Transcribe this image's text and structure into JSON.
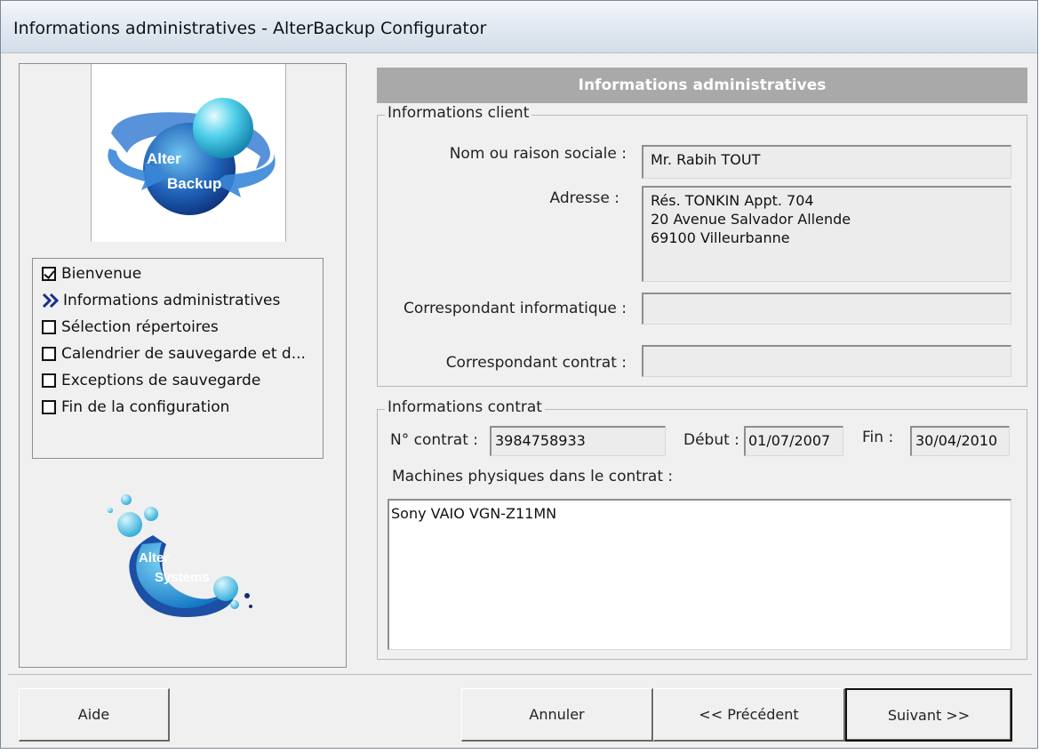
{
  "window": {
    "title": "Informations administratives - AlterBackup Configurator"
  },
  "branding": {
    "logo_top_line1": "Alter",
    "logo_top_line2": "Backup",
    "logo_bottom_line1": "Alter",
    "logo_bottom_line2": "Systems"
  },
  "nav": {
    "items": [
      {
        "label": "Bienvenue",
        "state": "checked"
      },
      {
        "label": "Informations administratives",
        "state": "current"
      },
      {
        "label": "Sélection répertoires",
        "state": "unchecked"
      },
      {
        "label": "Calendrier de sauvegarde et d...",
        "state": "unchecked"
      },
      {
        "label": "Exceptions de sauvegarde",
        "state": "unchecked"
      },
      {
        "label": "Fin de la configuration",
        "state": "unchecked"
      }
    ]
  },
  "header": {
    "title": "Informations administratives"
  },
  "client": {
    "legend": "Informations client",
    "name_label": "Nom ou raison sociale :",
    "name_value": "Mr. Rabih TOUT",
    "address_label": "Adresse :",
    "address_value": "Rés. TONKIN Appt. 704\n20 Avenue Salvador Allende\n69100 Villeurbanne",
    "it_contact_label": "Correspondant informatique :",
    "it_contact_value": "",
    "contract_contact_label": "Correspondant contrat :",
    "contract_contact_value": ""
  },
  "contract": {
    "legend": "Informations contrat",
    "number_label": "N° contrat :",
    "number_value": "3984758933",
    "start_label": "Début :",
    "start_value": "01/07/2007",
    "end_label": "Fin :",
    "end_value": "30/04/2010",
    "machines_label": "Machines physiques dans le contrat :",
    "machines_value": "Sony VAIO VGN-Z11MN"
  },
  "buttons": {
    "help": "Aide",
    "cancel": "Annuler",
    "previous": "<< Précédent",
    "next": "Suivant >>"
  }
}
